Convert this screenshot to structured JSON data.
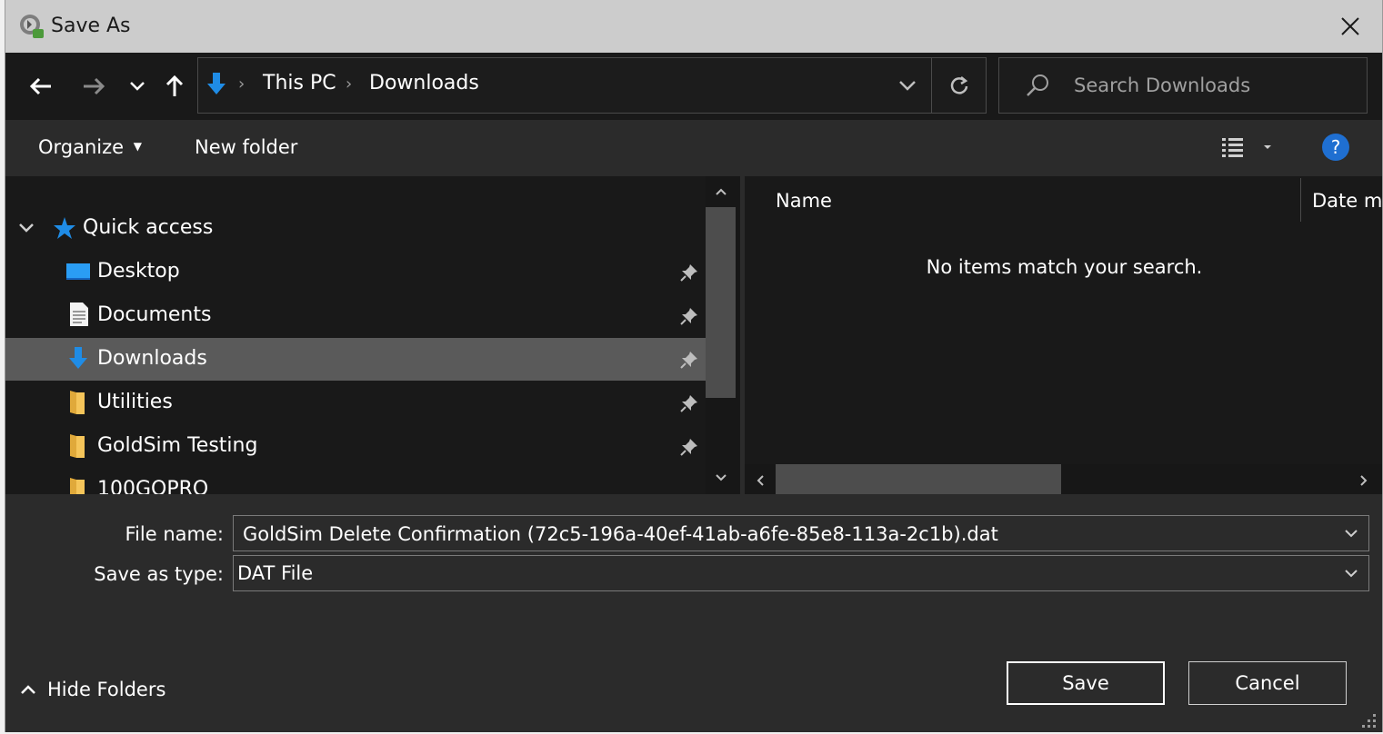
{
  "window": {
    "title": "Save As"
  },
  "address": {
    "segments": [
      "This PC",
      "Downloads"
    ]
  },
  "search": {
    "placeholder": "Search Downloads"
  },
  "toolbar": {
    "organize_label": "Organize",
    "new_folder_label": "New folder",
    "help_label": "?"
  },
  "nav": {
    "quick_access_label": "Quick access",
    "items": [
      {
        "label": "Desktop",
        "icon": "desktop-icon",
        "pinned": true
      },
      {
        "label": "Documents",
        "icon": "document-icon",
        "pinned": true
      },
      {
        "label": "Downloads",
        "icon": "download-arrow-icon",
        "pinned": true,
        "selected": true
      },
      {
        "label": "Utilities",
        "icon": "folder-icon",
        "pinned": true
      },
      {
        "label": "GoldSim Testing",
        "icon": "folder-icon",
        "pinned": true
      },
      {
        "label": "100GOPRO",
        "icon": "folder-icon",
        "pinned": false
      }
    ]
  },
  "filelist": {
    "columns": [
      "Name",
      "Date m"
    ],
    "empty_message": "No items match your search."
  },
  "form": {
    "file_name_label": "File name:",
    "file_name_value": "GoldSim Delete Confirmation (72c5-196a-40ef-41ab-a6fe-85e8-113a-2c1b).dat",
    "save_type_label": "Save as type:",
    "save_type_value": "DAT File"
  },
  "footer": {
    "hide_folders_label": "Hide Folders",
    "save_label": "Save",
    "cancel_label": "Cancel"
  },
  "colors": {
    "accent_blue": "#1f8ce6",
    "selection": "#5a5a5a",
    "folder_yellow": "#f5c55a"
  }
}
